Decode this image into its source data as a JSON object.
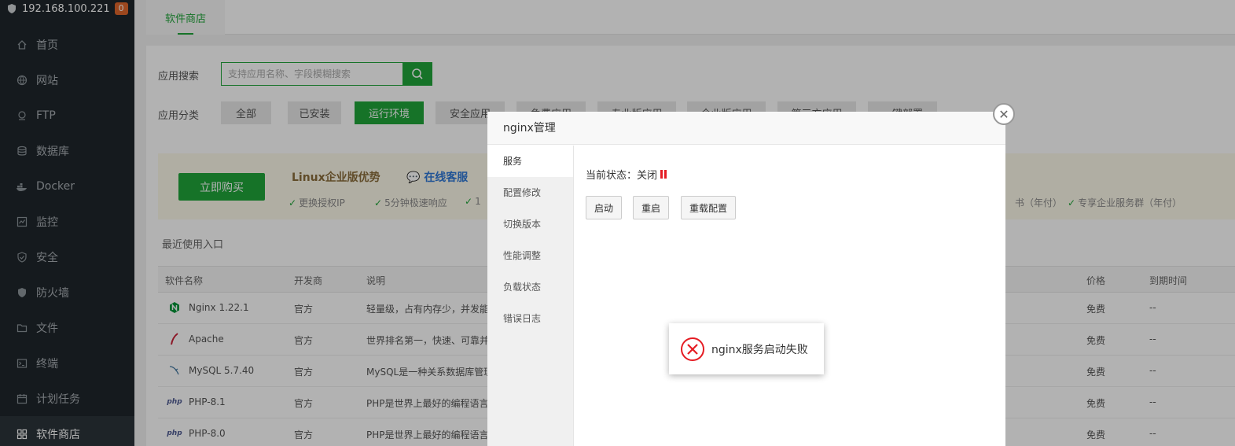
{
  "sidebar": {
    "host": "192.168.100.221",
    "badge": "0",
    "items": [
      {
        "label": "首页",
        "icon": "home-icon"
      },
      {
        "label": "网站",
        "icon": "globe-icon"
      },
      {
        "label": "FTP",
        "icon": "ftp-icon"
      },
      {
        "label": "数据库",
        "icon": "database-icon"
      },
      {
        "label": "Docker",
        "icon": "docker-icon"
      },
      {
        "label": "监控",
        "icon": "monitor-icon"
      },
      {
        "label": "安全",
        "icon": "shield-check-icon"
      },
      {
        "label": "防火墙",
        "icon": "firewall-icon"
      },
      {
        "label": "文件",
        "icon": "folder-icon"
      },
      {
        "label": "终端",
        "icon": "terminal-icon"
      },
      {
        "label": "计划任务",
        "icon": "calendar-icon"
      },
      {
        "label": "软件商店",
        "icon": "grid-icon",
        "active": true
      }
    ]
  },
  "top_tab": "软件商店",
  "search": {
    "label": "应用搜索",
    "placeholder": "支持应用名称、字段模糊搜索"
  },
  "categories": {
    "label": "应用分类",
    "items": [
      "全部",
      "已安装",
      "运行环境",
      "安全应用",
      "免费应用",
      "专业版应用",
      "企业版应用",
      "第三方应用",
      "一键部署"
    ],
    "active": "运行环境"
  },
  "promo": {
    "buy": "立即购买",
    "title": "Linux企业版优势",
    "online": "在线客服",
    "features": [
      "更换授权IP",
      "5分钟极速响应",
      "1",
      "书（年付）",
      "专享企业服务群（年付）"
    ]
  },
  "recent_label": "最近使用入口",
  "table": {
    "headers": [
      "软件名称",
      "开发商",
      "说明",
      "价格",
      "到期时间"
    ],
    "rows": [
      {
        "name": "Nginx 1.22.1",
        "vendor": "官方",
        "desc": "轻量级，占有内存少，并发能",
        "price": "免费",
        "expire": "--",
        "icon": "nginx-icon"
      },
      {
        "name": "Apache",
        "vendor": "官方",
        "desc": "世界排名第一，快速、可靠并",
        "price": "免费",
        "expire": "--",
        "icon": "apache-feather-icon"
      },
      {
        "name": "MySQL 5.7.40",
        "vendor": "官方",
        "desc": "MySQL是一种关系数据库管理",
        "price": "免费",
        "expire": "--",
        "icon": "mysql-dolphin-icon"
      },
      {
        "name": "PHP-8.1",
        "vendor": "官方",
        "desc": "PHP是世界上最好的编程语言",
        "price": "免费",
        "expire": "--",
        "icon": "php-icon"
      },
      {
        "name": "PHP-8.0",
        "vendor": "官方",
        "desc": "PHP是世界上最好的编程语言",
        "price": "免费",
        "expire": "--",
        "icon": "php-icon"
      }
    ]
  },
  "modal": {
    "title": "nginx管理",
    "nav": [
      "服务",
      "配置修改",
      "切换版本",
      "性能调整",
      "负载状态",
      "错误日志"
    ],
    "status_label": "当前状态：关闭",
    "buttons": [
      "启动",
      "重启",
      "重载配置"
    ]
  },
  "toast": {
    "message": "nginx服务启动失败"
  },
  "colors": {
    "brand": "#20a53a",
    "error": "#e51c23",
    "sidebar_bg": "#1f262b"
  }
}
